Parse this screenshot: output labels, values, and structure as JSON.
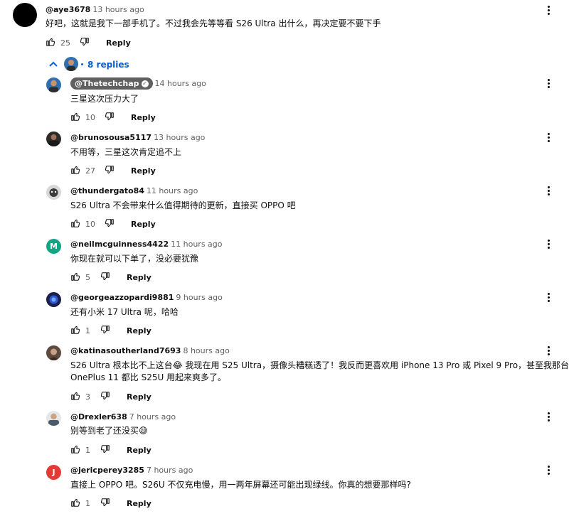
{
  "top_comment": {
    "handle": "@aye3678",
    "time": "13 hours ago",
    "text": "好吧，这就是我下一部手机了。不过我会先等等看 S26 Ultra 出什么，再决定要不要下手",
    "likes": "25",
    "reply_label": "Reply"
  },
  "replies_toggle": {
    "label": "8 replies"
  },
  "replies": [
    {
      "handle": "@Thetechchap",
      "time": "14 hours ago",
      "lines": [
        "三星这次压力大了"
      ],
      "likes": "10",
      "reply_label": "Reply",
      "avatar": {
        "type": "photo",
        "color": "#3b4a5c"
      }
    },
    {
      "handle": "@brunosousa5117",
      "time": "13 hours ago",
      "lines": [
        "不用等，三星这次肯定追不上"
      ],
      "likes": "27",
      "reply_label": "Reply",
      "avatar": {
        "type": "photo",
        "color": "#2e2a28"
      }
    },
    {
      "handle": "@thundergato84",
      "time": "11 hours ago",
      "lines": [
        "S26 Ultra 不会带来什么值得期待的更新，直接买 OPPO 吧"
      ],
      "likes": "10",
      "reply_label": "Reply",
      "avatar": {
        "type": "photo",
        "color": "#5a5a5a"
      }
    },
    {
      "handle": "@neilmcguinness4422",
      "time": "11 hours ago",
      "lines": [
        "你现在就可以下单了，没必要犹豫"
      ],
      "likes": "5",
      "reply_label": "Reply",
      "avatar": {
        "type": "letter",
        "letter": "M",
        "color": "#11a683"
      }
    },
    {
      "handle": "@georgeazzopardi9881",
      "time": "9 hours ago",
      "lines": [
        "还有小米 17 Ultra 呢，哈哈"
      ],
      "likes": "1",
      "reply_label": "Reply",
      "avatar": {
        "type": "photo",
        "color": "#1b1f4a"
      }
    },
    {
      "handle": "@katinasoutherland7693",
      "time": "8 hours ago",
      "lines": [
        "S26 Ultra 根本比不上这台😂 我现在用 S25 Ultra，摄像头糟糕透了！我反而更喜欢用 iPhone 13 Pro 或 Pixel 9 Pro，甚至我那台",
        "OnePlus 11 都比 S25U 用起来爽多了。"
      ],
      "likes": "3",
      "reply_label": "Reply",
      "avatar": {
        "type": "photo",
        "color": "#5c4a3c"
      }
    },
    {
      "handle": "@Drexler638",
      "time": "7 hours ago",
      "lines": [
        "别等到老了还没买😅"
      ],
      "likes": "1",
      "reply_label": "Reply",
      "avatar": {
        "type": "photo",
        "color": "#7a7a7a"
      }
    },
    {
      "handle": "@jericperey3285",
      "time": "7 hours ago",
      "lines": [
        "直接上 OPPO 吧。S26U 不仅充电慢，用一两年屏幕还可能出现绿线。你真的想要那样吗?"
      ],
      "likes": "1",
      "reply_label": "Reply",
      "avatar": {
        "type": "letter",
        "letter": "J",
        "color": "#e53935"
      }
    }
  ],
  "colors": {
    "link_blue": "#065fd4",
    "muted": "#606060",
    "text": "#0f0f0f"
  }
}
